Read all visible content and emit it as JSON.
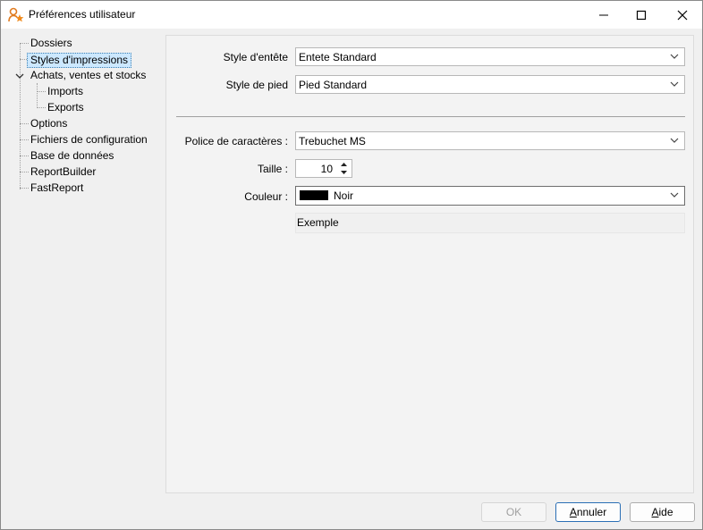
{
  "window": {
    "title": "Préférences utilisateur"
  },
  "tree": {
    "items": [
      {
        "label": "Dossiers"
      },
      {
        "label": "Styles d'impressions"
      },
      {
        "label": "Achats, ventes et stocks"
      },
      {
        "label": "Imports"
      },
      {
        "label": "Exports"
      },
      {
        "label": "Options"
      },
      {
        "label": "Fichiers de configuration"
      },
      {
        "label": "Base de données"
      },
      {
        "label": "ReportBuilder"
      },
      {
        "label": "FastReport"
      }
    ]
  },
  "form": {
    "header_style_label": "Style d'entête",
    "header_style_value": "Entete Standard",
    "footer_style_label": "Style de pied",
    "footer_style_value": "Pied Standard",
    "font_label": "Police de caractères :",
    "font_value": "Trebuchet MS",
    "size_label": "Taille :",
    "size_value": "10",
    "color_label": "Couleur :",
    "color_value": "Noir",
    "color_swatch": "#000000",
    "example_text": "Exemple"
  },
  "buttons": {
    "ok": "OK",
    "cancel": "Annuler",
    "cancel_rest": "nnuler",
    "cancel_mnemonic": "A",
    "help_mnemonic": "A",
    "help_rest": "ide"
  }
}
